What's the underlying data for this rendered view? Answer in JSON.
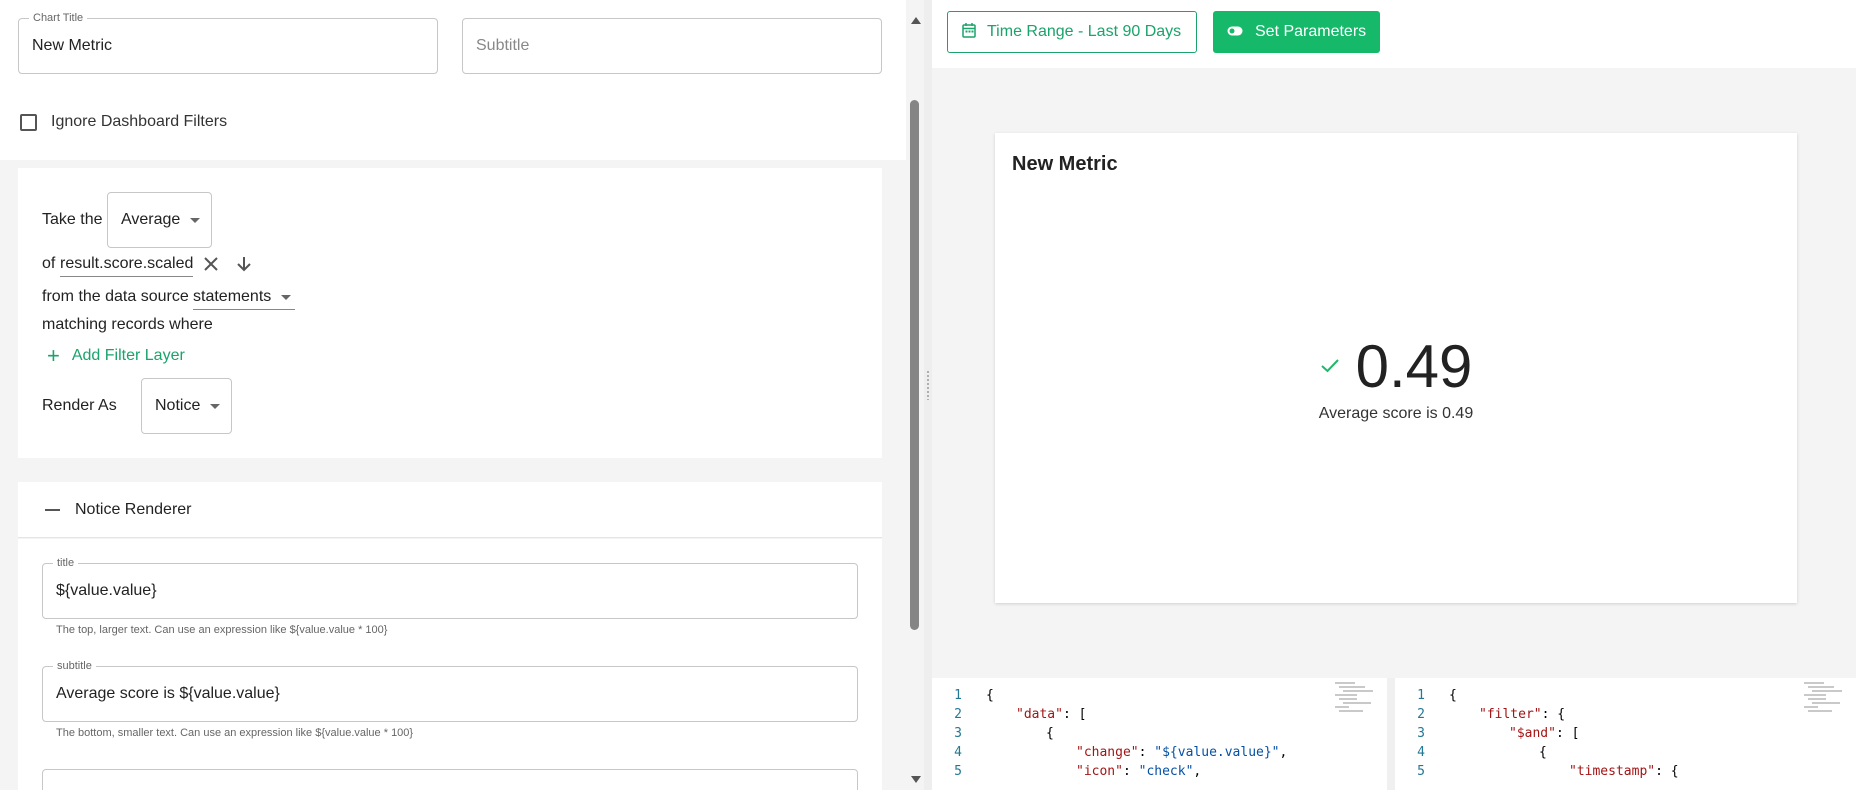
{
  "form": {
    "chart_title_label": "Chart Title",
    "chart_title_value": "New Metric",
    "subtitle_placeholder": "Subtitle",
    "ignore_filters_label": "Ignore Dashboard Filters"
  },
  "query": {
    "take_the": "Take the",
    "aggregate": "Average",
    "of": "of",
    "field": "result.score.scaled",
    "from_source": "from the data source",
    "source": "statements",
    "matching": "matching records where",
    "add_filter": "Add Filter Layer",
    "render_as": "Render As",
    "renderer": "Notice"
  },
  "renderer_section": {
    "title": "Notice Renderer",
    "title_field_label": "title",
    "title_field_value": "${value.value}",
    "title_helper": "The top, larger text. Can use an expression like ${value.value * 100}",
    "subtitle_field_label": "subtitle",
    "subtitle_field_value": "Average score is ${value.value}",
    "subtitle_helper": "The bottom, smaller text. Can use an expression like ${value.value * 100}"
  },
  "toolbar": {
    "time_range": "Time Range - Last 90 Days",
    "set_parameters": "Set Parameters"
  },
  "preview": {
    "title": "New Metric",
    "value": "0.49",
    "subtitle": "Average score is 0.49",
    "icon": "check-icon"
  },
  "editor_left": {
    "lines": [
      {
        "n": "1",
        "indent": 0,
        "text": "{"
      },
      {
        "n": "2",
        "indent": 1,
        "key": "\"data\"",
        "rest": ": ["
      },
      {
        "n": "3",
        "indent": 2,
        "text": "{"
      },
      {
        "n": "4",
        "indent": 3,
        "key": "\"change\"",
        "rest": ": ",
        "str": "\"${value.value}\"",
        "tail": ","
      },
      {
        "n": "5",
        "indent": 3,
        "key": "\"icon\"",
        "rest": ": ",
        "str": "\"check\"",
        "tail": ","
      }
    ]
  },
  "editor_right": {
    "lines": [
      {
        "n": "1",
        "indent": 0,
        "text": "{"
      },
      {
        "n": "2",
        "indent": 1,
        "key": "\"filter\"",
        "rest": ": {"
      },
      {
        "n": "3",
        "indent": 2,
        "key": "\"$and\"",
        "rest": ": ["
      },
      {
        "n": "4",
        "indent": 3,
        "text": "{"
      },
      {
        "n": "5",
        "indent": 4,
        "key": "\"timestamp\"",
        "rest": ": {"
      }
    ]
  },
  "colors": {
    "accent": "#16b86a",
    "check": "#1fb86c"
  }
}
